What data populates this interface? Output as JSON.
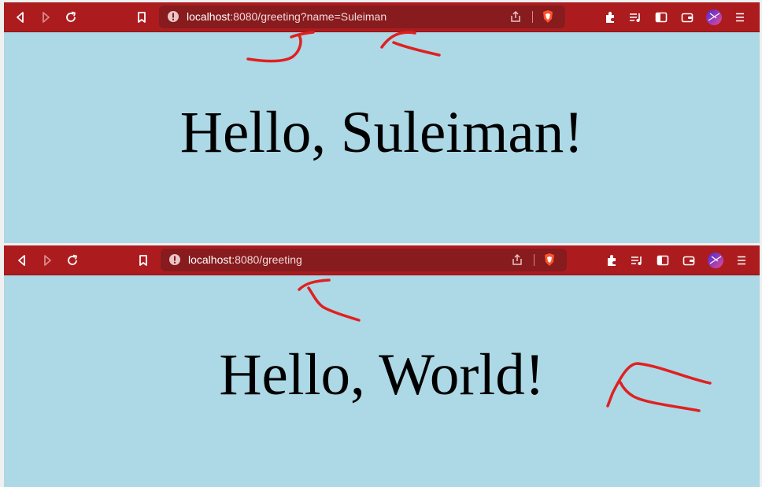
{
  "windows": [
    {
      "address": {
        "host": "localhost",
        "rest": ":8080/greeting?name=Suleiman"
      },
      "greeting": "Hello, Suleiman!"
    },
    {
      "address": {
        "host": "localhost",
        "rest": ":8080/greeting"
      },
      "greeting": "Hello, World!"
    }
  ],
  "toolbar": {
    "left_icons": [
      "back-icon",
      "forward-icon",
      "reload-icon",
      "bookmark-icon"
    ],
    "right_icons": [
      "extensions-icon",
      "playlist-icon",
      "sidebar-icon",
      "wallet-icon",
      "profile-avatar",
      "menu-icon"
    ]
  },
  "colors": {
    "toolbar": "#ac1c1f",
    "urlbar": "#871b1e",
    "page_background": "#add8e6",
    "annotation": "#e02020"
  }
}
